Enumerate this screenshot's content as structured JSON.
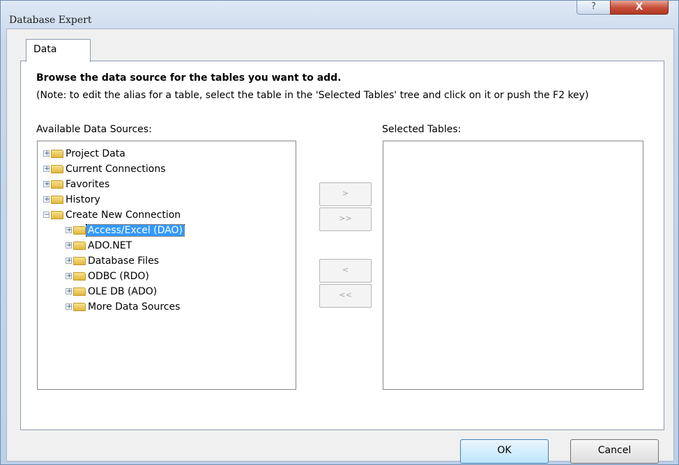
{
  "window": {
    "title": "Database Expert",
    "help_glyph": "?",
    "close_glyph": "X"
  },
  "tabs": [
    {
      "label": "Data"
    }
  ],
  "panel": {
    "heading": "Browse the data source for the tables you want to add.",
    "note": "(Note: to edit the alias for a table, select the table in the 'Selected Tables' tree and click on it or push the F2 key)",
    "available_label": "Available Data Sources:",
    "selected_label": "Selected Tables:"
  },
  "tree": {
    "expander_glyph": "+",
    "collapser_glyph": "−",
    "items": [
      {
        "label": "Project Data",
        "level": 0,
        "expanded": false,
        "selected": false
      },
      {
        "label": "Current Connections",
        "level": 0,
        "expanded": false,
        "selected": false
      },
      {
        "label": "Favorites",
        "level": 0,
        "expanded": false,
        "selected": false
      },
      {
        "label": "History",
        "level": 0,
        "expanded": false,
        "selected": false
      },
      {
        "label": "Create New Connection",
        "level": 0,
        "expanded": true,
        "selected": false
      },
      {
        "label": "Access/Excel (DAO)",
        "level": 1,
        "expanded": false,
        "selected": true
      },
      {
        "label": "ADO.NET",
        "level": 1,
        "expanded": false,
        "selected": false
      },
      {
        "label": "Database Files",
        "level": 1,
        "expanded": false,
        "selected": false
      },
      {
        "label": "ODBC (RDO)",
        "level": 1,
        "expanded": false,
        "selected": false
      },
      {
        "label": "OLE DB (ADO)",
        "level": 1,
        "expanded": false,
        "selected": false
      },
      {
        "label": "More Data Sources",
        "level": 1,
        "expanded": false,
        "selected": false
      }
    ]
  },
  "transfer_buttons": {
    "add": ">",
    "add_all": ">>",
    "remove": "<",
    "remove_all": "<<"
  },
  "footer": {
    "ok_label": "OK",
    "cancel_label": "Cancel"
  },
  "colors": {
    "selection": "#3399ff",
    "close_button": "#c74b36",
    "window_frame": "#bcd0e8"
  }
}
